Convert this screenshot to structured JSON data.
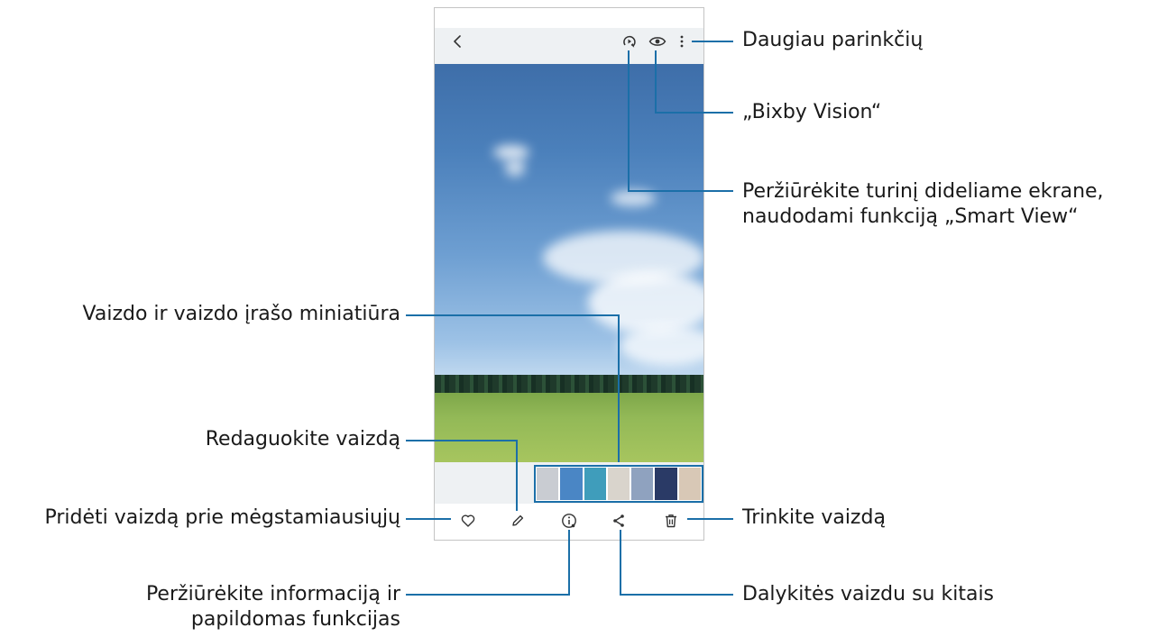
{
  "callouts": {
    "more_options": "Daugiau parinkčių",
    "bixby_vision": "„Bixby Vision“",
    "smart_view_line1": "Peržiūrėkite turinį dideliame ekrane,",
    "smart_view_line2": "naudodami funkciją „Smart View“",
    "thumbnails": "Vaizdo ir vaizdo įrašo miniatiūra",
    "edit": "Redaguokite vaizdą",
    "favorite": "Pridėti vaizdą prie mėgstamiausiųjų",
    "delete": "Trinkite vaizdą",
    "info_line1": "Peržiūrėkite informaciją ir",
    "info_line2": "papildomas funkcijas",
    "share": "Dalykitės vaizdu su kitais"
  },
  "icons": {
    "back": "back-icon",
    "smart_view": "smart-view-icon",
    "bixby_vision": "eye-icon",
    "more": "more-vertical-icon",
    "favorite": "heart-icon",
    "edit": "pencil-icon",
    "info": "info-icon",
    "share": "share-icon",
    "delete": "trash-icon"
  },
  "colors": {
    "callout_line": "#1b6fa8",
    "thumbnail_frame": "#1b6fa8",
    "icon": "#333333"
  },
  "thumbnails": [
    {
      "color": "#c9ccd2"
    },
    {
      "color": "#4a86c5"
    },
    {
      "color": "#3f9dbb"
    },
    {
      "color": "#d9d4cc"
    },
    {
      "color": "#8fa2bf"
    },
    {
      "color": "#2a3a66"
    },
    {
      "color": "#d8c8b6"
    }
  ]
}
